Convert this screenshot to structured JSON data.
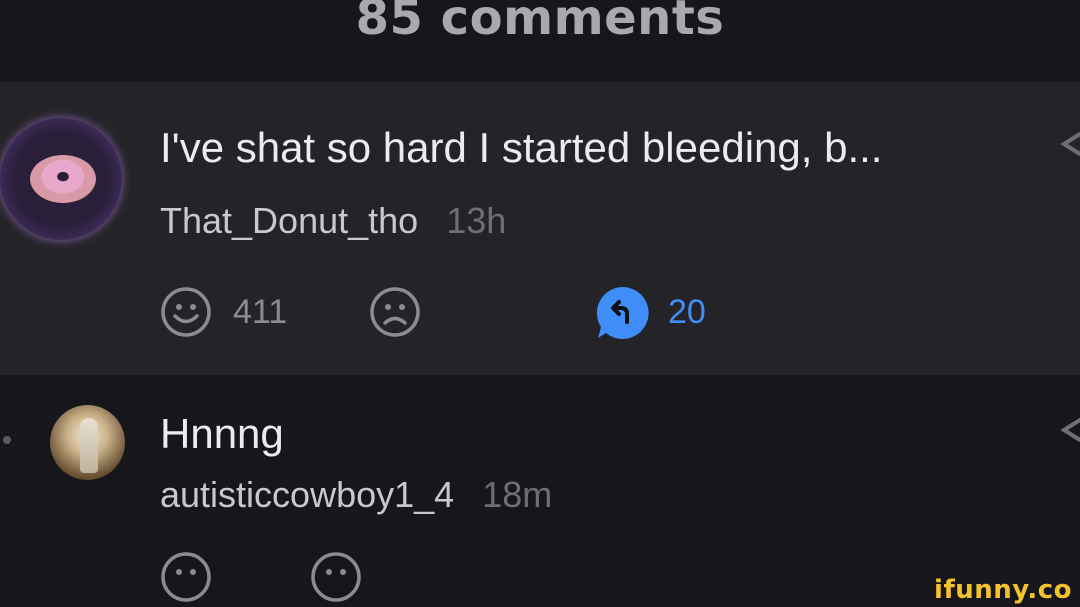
{
  "header": {
    "title": "85 comments"
  },
  "comments": [
    {
      "text": "I've shat so hard I started bleeding, b...",
      "username": "That_Donut_tho",
      "time": "13h",
      "smile_count": "411",
      "reply_count": "20"
    },
    {
      "text": "Hnnng",
      "username": "autisticcowboy1_4",
      "time": "18m"
    }
  ],
  "watermark": "ifunny.co",
  "colors": {
    "reply_accent": "#3f8df7",
    "background": "#17171b",
    "highlight_row": "#242428",
    "watermark": "#f5c22b"
  },
  "icons": [
    "smile-icon",
    "frown-icon",
    "reply-icon",
    "share-icon"
  ]
}
